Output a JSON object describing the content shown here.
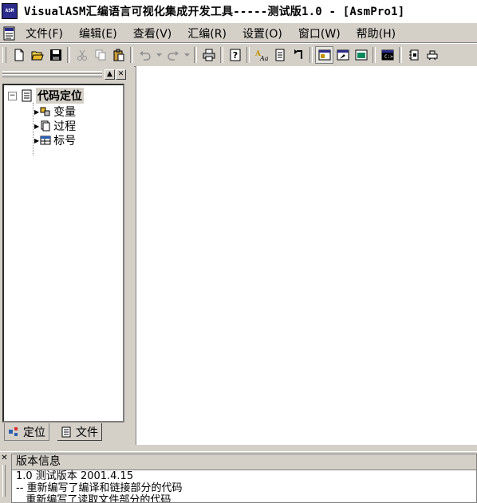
{
  "window": {
    "title": "VisualASM汇编语言可视化集成开发工具-----测试版1.0 - [AsmPro1]",
    "app_icon_text": "ASM"
  },
  "menu": {
    "items": [
      "文件(F)",
      "编辑(E)",
      "查看(V)",
      "汇编(R)",
      "设置(O)",
      "窗口(W)",
      "帮助(H)"
    ]
  },
  "toolbar": {
    "buttons": [
      "new-file",
      "open-folder",
      "save",
      "cut",
      "copy",
      "paste",
      "undo",
      "redo",
      "print",
      "help",
      "font",
      "document",
      "goto",
      "window",
      "build",
      "view",
      "console",
      "debug",
      "run"
    ]
  },
  "left_panel": {
    "tree": {
      "root": {
        "label": "代码定位",
        "expanded": true
      },
      "children": [
        {
          "label": "变量"
        },
        {
          "label": "过程"
        },
        {
          "label": "标号"
        }
      ]
    },
    "tabs": [
      {
        "label": "定位",
        "active": true
      },
      {
        "label": "文件",
        "active": false
      }
    ]
  },
  "output_panel": {
    "title": "版本信息",
    "lines": [
      "1.0 测试版本 2001.4.15",
      "-- 重新编写了编译和链接部分的代码",
      "   重新编写了读取文件部分的代码"
    ]
  }
}
